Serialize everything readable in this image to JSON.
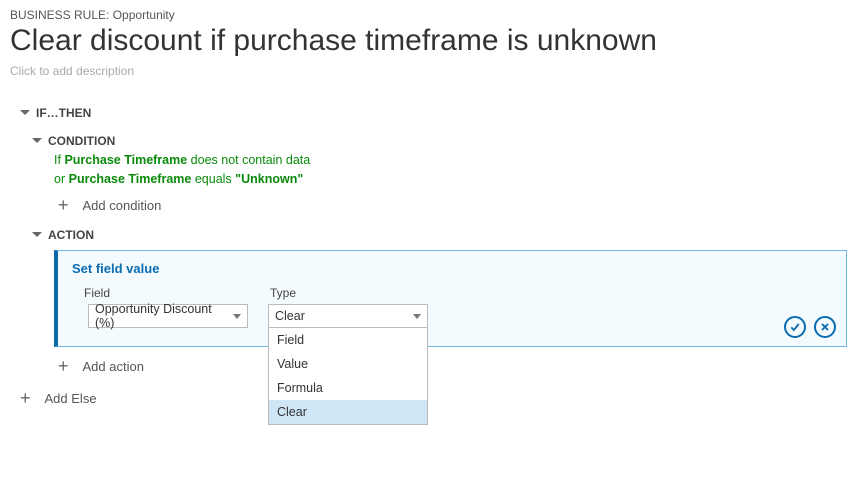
{
  "breadcrumb": {
    "prefix": "BUSINESS RULE:",
    "entity": "Opportunity"
  },
  "title": "Clear discount if purchase timeframe is unknown",
  "description_placeholder": "Click to add description",
  "sections": {
    "ifthen_label": "IF…THEN",
    "condition_label": "CONDITION",
    "action_label": "ACTION"
  },
  "conditions": [
    {
      "kw": "If",
      "field": "Purchase Timeframe",
      "op": "does not contain data",
      "val": ""
    },
    {
      "kw": "or",
      "field": "Purchase Timeframe",
      "op": "equals",
      "val": "\"Unknown\""
    }
  ],
  "add_condition_label": "Add condition",
  "action_card": {
    "title": "Set field value",
    "field_label": "Field",
    "field_value": "Opportunity Discount (%)",
    "type_label": "Type",
    "type_value": "Clear",
    "type_options": [
      "Field",
      "Value",
      "Formula",
      "Clear"
    ],
    "type_selected": "Clear"
  },
  "add_action_label": "Add action",
  "add_else_label": "Add Else"
}
